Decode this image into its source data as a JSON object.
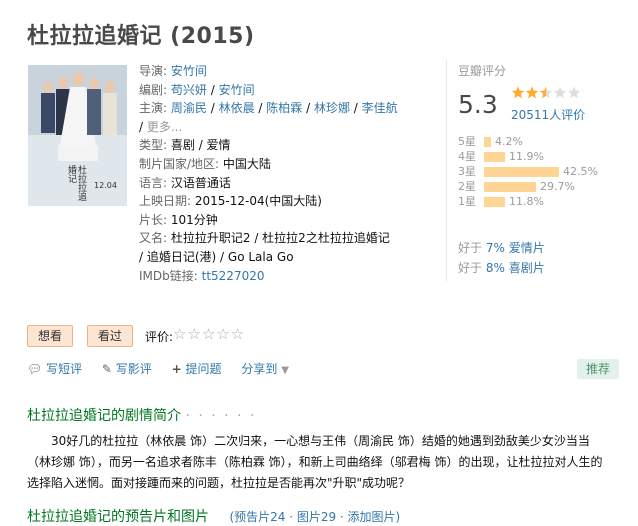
{
  "title": "杜拉拉追婚记 (2015)",
  "poster": {
    "caption": "杜拉拉追婚记",
    "date_text": "12.04"
  },
  "info": {
    "director_label": "导演:",
    "director": "安竹间",
    "writer_label": "编剧:",
    "writers": [
      "苟兴妍",
      "安竹间"
    ],
    "cast_label": "主演:",
    "cast": [
      "周渝民",
      "林依晨",
      "陈柏霖",
      "林珍娜",
      "李佳航"
    ],
    "more": "更多...",
    "genre_label": "类型:",
    "genre": "喜剧 / 爱情",
    "country_label": "制片国家/地区:",
    "country": "中国大陆",
    "language_label": "语言:",
    "language": "汉语普通话",
    "release_label": "上映日期:",
    "release": "2015-12-04(中国大陆)",
    "runtime_label": "片长:",
    "runtime": "101分钟",
    "aka_label": "又名:",
    "aka1": "杜拉拉升职记2 / 杜拉拉2之杜拉拉追婚记",
    "aka2": "/ 追婚日记(港) / Go Lala Go",
    "imdb_label": "IMDb链接:",
    "imdb": "tt5227020"
  },
  "rating": {
    "label": "豆瓣评分",
    "score": "5.3",
    "stars": 2.5,
    "count_text": "20511人评价",
    "breakdown": [
      {
        "label": "5星",
        "pct": 4.2,
        "text": "4.2%"
      },
      {
        "label": "4星",
        "pct": 11.9,
        "text": "11.9%"
      },
      {
        "label": "3星",
        "pct": 42.5,
        "text": "42.5%"
      },
      {
        "label": "2星",
        "pct": 29.7,
        "text": "29.7%"
      },
      {
        "label": "1星",
        "pct": 11.8,
        "text": "11.8%"
      }
    ],
    "better1_prefix": "好于",
    "better1_pct": "7%",
    "better1_genre": "爱情片",
    "better2_prefix": "好于",
    "better2_pct": "8%",
    "better2_genre": "喜剧片"
  },
  "actions": {
    "want": "想看",
    "seen": "看过",
    "rate_label": "评价:",
    "rate_stars": "☆☆☆☆☆"
  },
  "tools": {
    "short_review": "写短评",
    "long_review": "写影评",
    "question": "提问题",
    "share": "分享到",
    "recommend": "推荐"
  },
  "summary": {
    "heading": "杜拉拉追婚记的剧情简介",
    "dots": "· · · · · ·",
    "text": "30好几的杜拉拉（林依晨 饰）二次归来，一心想与王伟（周渝民 饰）结婚的她遇到劲敌美少女沙当当（林珍娜 饰），而另一名追求者陈丰（陈柏霖 饰），和新上司曲络绎（邬君梅 饰）的出现，让杜拉拉对人生的选择陷入迷惘。面对接踵而来的问题，杜拉拉是否能再次\"升职\"成功呢？"
  },
  "next_section": {
    "heading": "杜拉拉追婚记的预告片和图片",
    "sub": "(预告片24 · 图片29 · 添加图片)"
  }
}
